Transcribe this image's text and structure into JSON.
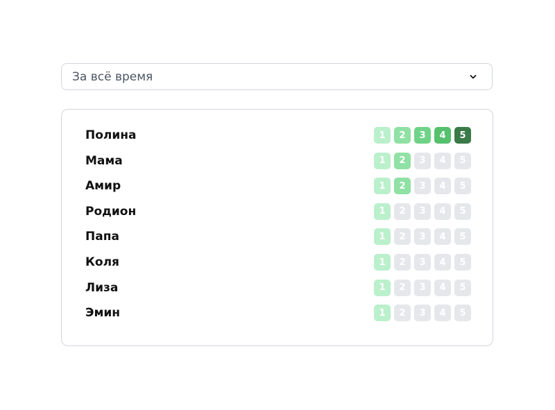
{
  "filter": {
    "selected": "За всё время",
    "icon": "chevron-down-icon"
  },
  "level_colors": {
    "1": "#bbf0cc",
    "2": "#8fe1a4",
    "3": "#6fd387",
    "4": "#55c06e",
    "5": "#3a7a47",
    "off": "#e5e7eb"
  },
  "level_labels": [
    "1",
    "2",
    "3",
    "4",
    "5"
  ],
  "people": [
    {
      "name": "Полина",
      "level": 5
    },
    {
      "name": "Мама",
      "level": 2
    },
    {
      "name": "Амир",
      "level": 2
    },
    {
      "name": "Родион",
      "level": 1
    },
    {
      "name": "Папа",
      "level": 1
    },
    {
      "name": "Коля",
      "level": 1
    },
    {
      "name": "Лиза",
      "level": 1
    },
    {
      "name": "Эмин",
      "level": 1
    }
  ]
}
